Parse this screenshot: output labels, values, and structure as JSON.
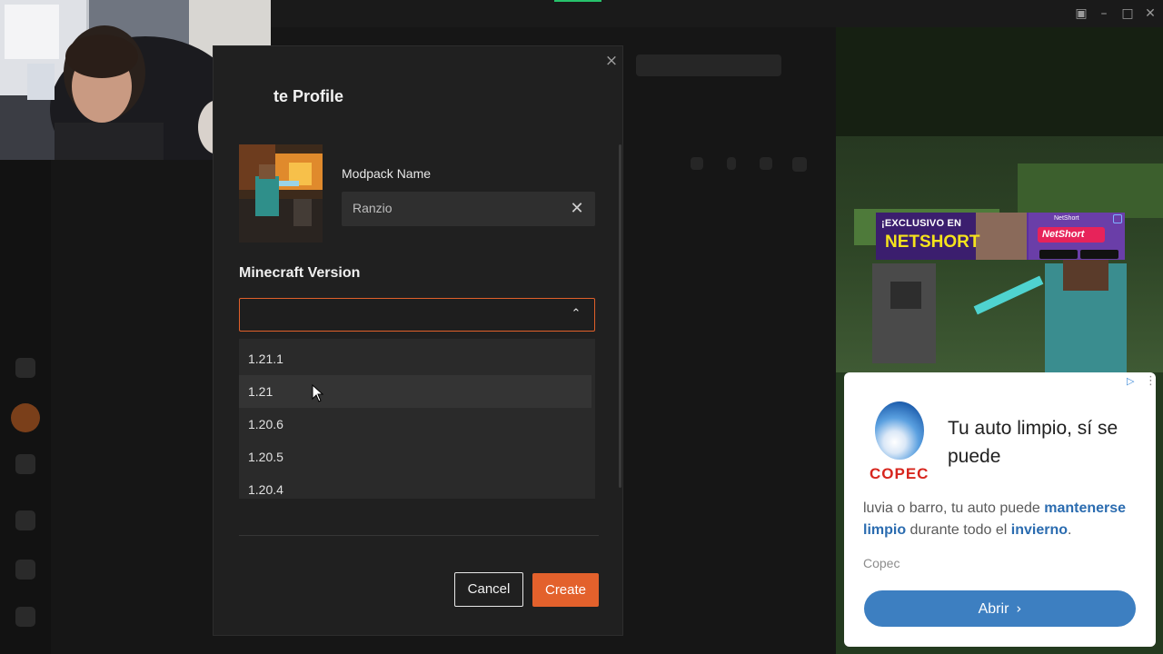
{
  "modal": {
    "title": "te Profile",
    "close_icon": "×",
    "modpack_label": "Modpack Name",
    "modpack_value": "Ranzio",
    "clear_icon": "✕",
    "version_label": "Minecraft Version",
    "select_chevron": "⌃",
    "versions": [
      "1.21.1",
      "1.21",
      "1.20.6",
      "1.20.5",
      "1.20.4"
    ],
    "hovered_version": "1.21",
    "cancel_label": "Cancel",
    "create_label": "Create"
  },
  "window": {
    "controls": [
      "▣",
      "–",
      "□",
      "✕"
    ]
  },
  "banner_ad": {
    "line1": "¡EXCLUSIVO EN",
    "line2": "NETSHORT",
    "app_name": "NetShort",
    "app_tag": "NetShort"
  },
  "ad": {
    "brand": "COPEC",
    "headline": "Tu auto limpio, sí se puede",
    "body_parts": [
      "luvia o barro, tu auto puede ",
      "mantenerse limpio",
      " durante todo el ",
      "invierno",
      "."
    ],
    "advertiser": "Copec",
    "cta_label": "Abrir",
    "cta_icon": "›",
    "info_icon": "▷",
    "menu_icon": "⋮"
  },
  "colors": {
    "accent": "#e3612c",
    "select_border": "#e0602a",
    "ad_cta": "#3d7fc1",
    "ad_highlight": "#2b6cb0"
  }
}
